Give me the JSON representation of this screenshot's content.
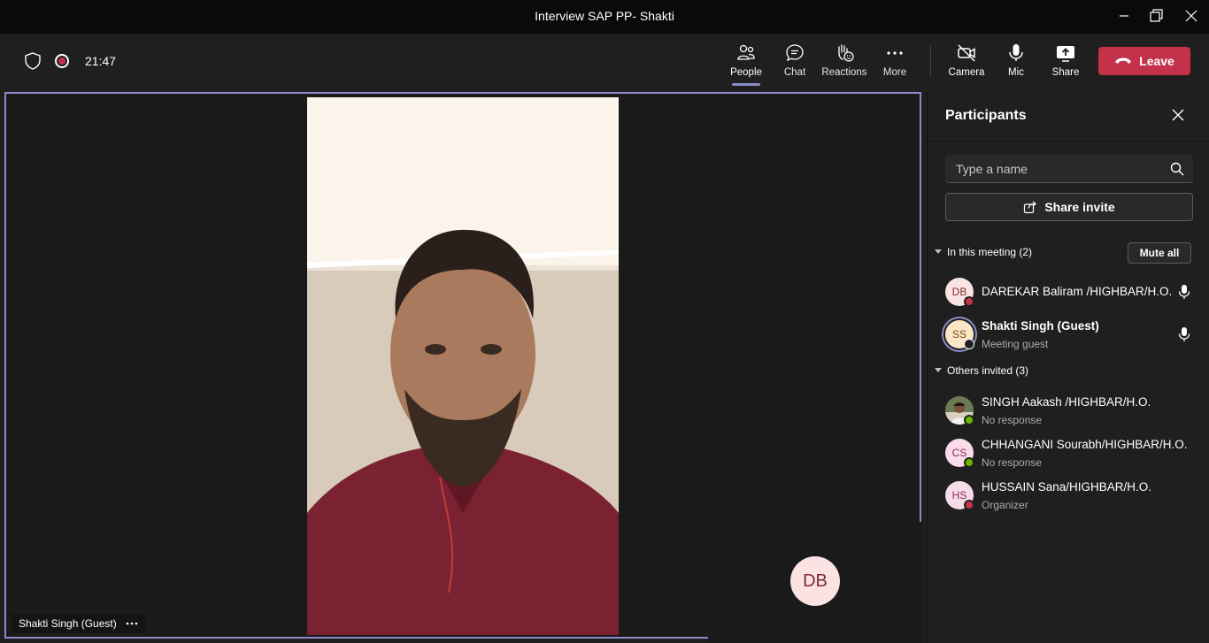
{
  "window": {
    "title": "Interview SAP PP- Shakti"
  },
  "toolbar": {
    "timer": "21:47",
    "people_label": "People",
    "chat_label": "Chat",
    "reactions_label": "Reactions",
    "more_label": "More",
    "camera_label": "Camera",
    "mic_label": "Mic",
    "share_label": "Share",
    "leave_label": "Leave",
    "leave_color": "#c4314b",
    "accent_color": "#8b8cc7"
  },
  "stage": {
    "speaker_name": "Shakti Singh (Guest)",
    "pip_initials": "DB"
  },
  "panel": {
    "title": "Participants",
    "search_placeholder": "Type a name",
    "share_invite_label": "Share invite",
    "in_meeting_label": "In this meeting (2)",
    "mute_all_label": "Mute all",
    "others_invited_label": "Others invited (3)",
    "in_meeting": [
      {
        "initials": "DB",
        "name": "DAREKAR Baliram /HIGHBAR/H.O.",
        "sub": "",
        "status": "busy"
      },
      {
        "initials": "SS",
        "name": "Shakti Singh (Guest)",
        "sub": "Meeting guest",
        "status": "unknown"
      }
    ],
    "invited": [
      {
        "initials": "",
        "name": "SINGH Aakash /HIGHBAR/H.O.",
        "sub": "No response",
        "status": "available"
      },
      {
        "initials": "CS",
        "name": "CHHANGANI Sourabh/HIGHBAR/H.O.",
        "sub": "No response",
        "status": "available"
      },
      {
        "initials": "HS",
        "name": "HUSSAIN Sana/HIGHBAR/H.O.",
        "sub": "Organizer",
        "status": "busy"
      }
    ]
  }
}
